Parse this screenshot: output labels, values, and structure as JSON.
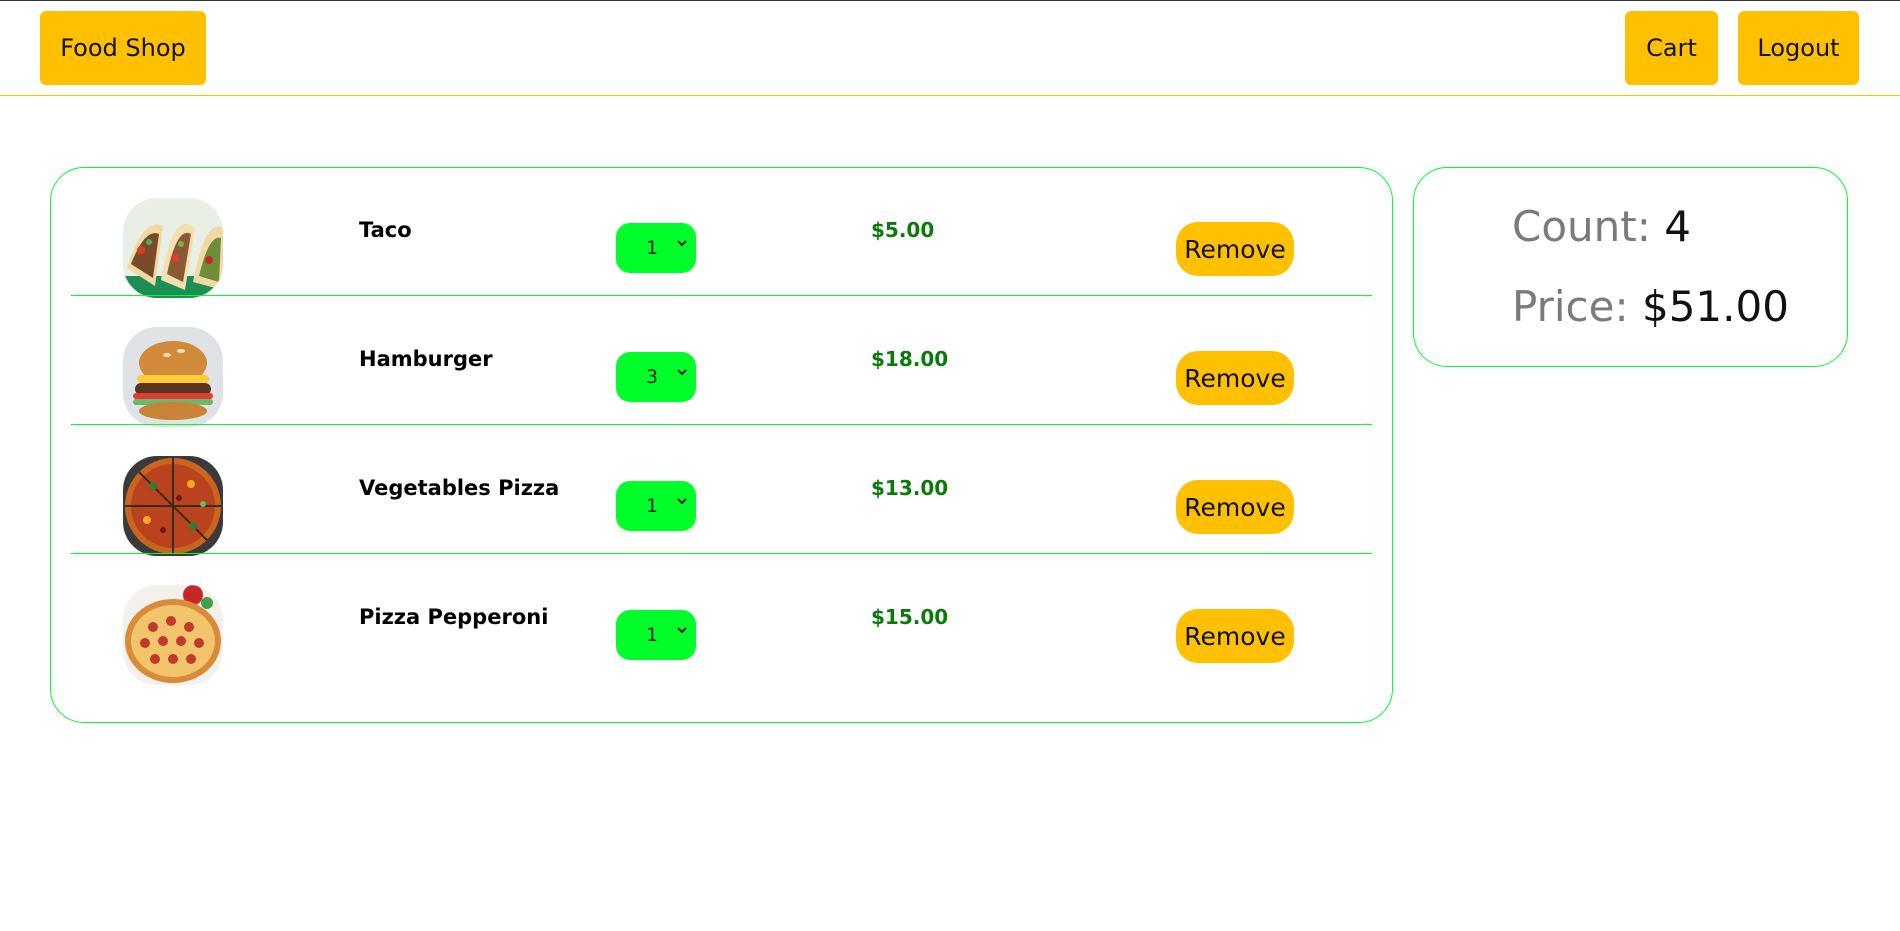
{
  "nav": {
    "brand": "Food Shop",
    "cart": "Cart",
    "logout": "Logout"
  },
  "cart": {
    "items": [
      {
        "name": "Taco",
        "quantity": "1",
        "price": "$5.00",
        "remove": "Remove",
        "image": "taco-image"
      },
      {
        "name": "Hamburger",
        "quantity": "3",
        "price": "$18.00",
        "remove": "Remove",
        "image": "hamburger-image"
      },
      {
        "name": "Vegetables Pizza",
        "quantity": "1",
        "price": "$13.00",
        "remove": "Remove",
        "image": "vegetable-pizza-image"
      },
      {
        "name": "Pizza Pepperoni",
        "quantity": "1",
        "price": "$15.00",
        "remove": "Remove",
        "image": "pepperoni-pizza-image"
      }
    ]
  },
  "summary": {
    "count_label": "Count:",
    "count_value": "4",
    "price_label": "Price:",
    "price_value": "$51.00"
  },
  "colors": {
    "accent": "#ffc000",
    "green": "#00ff2a",
    "price_text": "#0a7a0a"
  }
}
